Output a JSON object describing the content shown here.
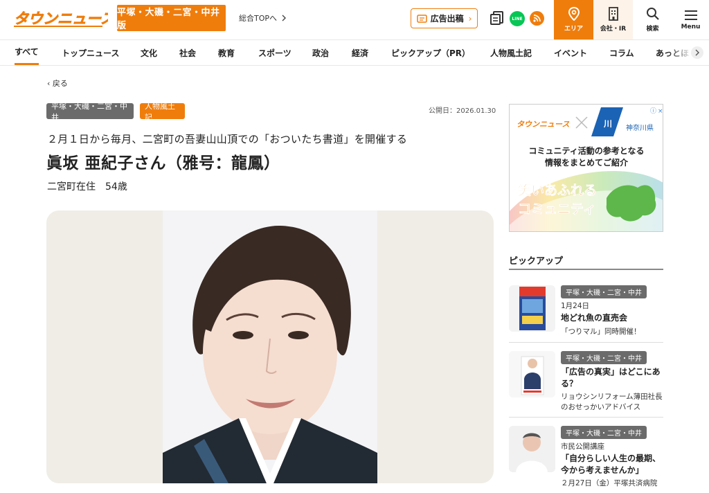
{
  "header": {
    "logo_text": "タウンニュース",
    "area_badge": "平塚・大磯・二宮・中井版",
    "top_link": "総合TOPへ",
    "ad_button": "広告出稿",
    "buttons": {
      "area": "エリア",
      "ir": "会社・IR",
      "search": "検索",
      "menu": "Menu"
    },
    "line_label": "LINE"
  },
  "nav": {
    "items": [
      "すべて",
      "トップニュース",
      "文化",
      "社会",
      "教育",
      "スポーツ",
      "政治",
      "経済",
      "ピックアップ（PR）",
      "人物風土記",
      "イベント",
      "コラム",
      "あっとほ"
    ],
    "active": "すべて"
  },
  "article": {
    "back": "戻る",
    "tags": [
      "平塚・大磯・二宮・中井",
      "人物風土記"
    ],
    "published": "公開日：2026.01.30",
    "subtitle": "２月１日から毎月、二宮町の吾妻山山頂での「おついたち書道」を開催する",
    "title": "眞坂 亜紀子さん（雅号：龍鳳）",
    "meta": "二宮町在住　54歳"
  },
  "banner": {
    "logo_text": "タウンニュース",
    "pref_name": "神奈川県",
    "line1": "コミュニティ活動の参考となる",
    "line2": "情報をまとめてご紹介",
    "big1": "笑いあふれる",
    "big2": "コミュニティ"
  },
  "sidebar": {
    "heading": "ピックアップ",
    "items": [
      {
        "tag": "平塚・大磯・二宮・中井",
        "date": "1月24日",
        "title": "地どれ魚の直売会",
        "desc": "「つりマル」同時開催！"
      },
      {
        "tag": "平塚・大磯・二宮・中井",
        "title": "「広告の真実」はどこにある？",
        "desc": "リョウシンリフォーム薄田社長のおせっかいアドバイス"
      },
      {
        "tag": "平塚・大磯・二宮・中井",
        "label": "市民公開講座",
        "title": "「自分らしい人生の最期、今から考えませんか」",
        "desc": "２月27日（金）平塚共済病院"
      }
    ]
  },
  "colors": {
    "accent": "#ef7d0c",
    "tag_gray": "#6b6b6b",
    "line_green": "#06c755"
  }
}
